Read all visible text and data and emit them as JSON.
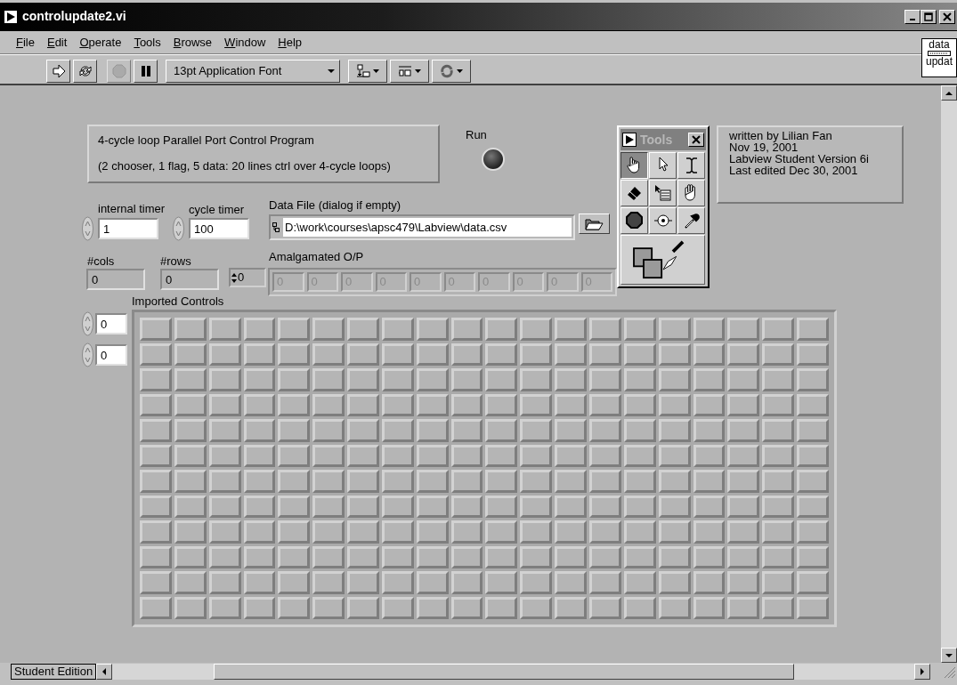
{
  "window": {
    "title": "controlupdate2.vi"
  },
  "menu": [
    {
      "label": "File"
    },
    {
      "label": "Edit"
    },
    {
      "label": "Operate"
    },
    {
      "label": "Tools"
    },
    {
      "label": "Browse"
    },
    {
      "label": "Window"
    },
    {
      "label": "Help"
    }
  ],
  "toolbar": {
    "buttons": [
      {
        "kind": "run",
        "disabled": false
      },
      {
        "kind": "run-continuously",
        "disabled": false
      },
      {
        "kind": "abort",
        "disabled": true
      },
      {
        "kind": "pause",
        "disabled": false
      }
    ],
    "font": "13pt Application Font",
    "tools": [
      {
        "kind": "align"
      },
      {
        "kind": "distribute"
      },
      {
        "kind": "reorder"
      }
    ]
  },
  "connector_pane": {
    "lines": [
      "data",
      "updat"
    ]
  },
  "panel": {
    "title_box": {
      "lines": [
        "4-cycle loop Parallel Port Control Program",
        "(2 chooser, 1 flag, 5 data: 20 lines ctrl over 4-cycle loops)"
      ]
    },
    "run_led": {
      "label": "Run",
      "on": false
    },
    "tools_palette": {
      "title": "Tools",
      "tools": [
        {
          "kind": "operate",
          "selected": true
        },
        {
          "kind": "position",
          "selected": false
        },
        {
          "kind": "text",
          "selected": false
        },
        {
          "kind": "wire",
          "selected": false
        },
        {
          "kind": "shortcut-menu",
          "selected": false
        },
        {
          "kind": "scroll",
          "selected": false
        },
        {
          "kind": "breakpoint",
          "selected": false
        },
        {
          "kind": "probe",
          "selected": false
        },
        {
          "kind": "color-copy",
          "selected": false
        },
        {
          "kind": "coloring",
          "selected": false
        }
      ]
    },
    "info_box": {
      "lines": [
        "written by Lilian Fan",
        "Nov 19, 2001",
        "Labview Student Version 6i",
        "Last edited Dec 30, 2001"
      ]
    },
    "internal_timer": {
      "label": "internal timer",
      "value": "1"
    },
    "cycle_timer": {
      "label": "cycle timer",
      "value": "100"
    },
    "data_file": {
      "label": "Data File (dialog if empty)",
      "value": "D:\\work\\courses\\apsc479\\Labview\\data.csv"
    },
    "cols": {
      "label": "#cols",
      "value": "0"
    },
    "rows": {
      "label": "#rows",
      "value": "0"
    },
    "amalgamated": {
      "label": "Amalgamated O/P",
      "index": "0",
      "disabled": true,
      "values": [
        "0",
        "0",
        "0",
        "0",
        "0",
        "0",
        "0",
        "0",
        "0",
        "0"
      ]
    },
    "imported_controls": {
      "label": "Imported Controls",
      "indices": [
        "0",
        "0"
      ],
      "rows": [
        {
          "buttons_on": [
            false,
            false,
            false,
            false,
            false,
            false,
            false,
            false,
            false,
            false,
            false,
            false,
            false,
            false,
            false,
            false,
            false,
            false,
            false,
            false
          ]
        },
        {
          "buttons_on": [
            false,
            false,
            false,
            false,
            false,
            false,
            false,
            false,
            false,
            false,
            false,
            false,
            false,
            false,
            false,
            false,
            false,
            false,
            false,
            false
          ]
        },
        {
          "buttons_on": [
            false,
            false,
            false,
            false,
            false,
            false,
            false,
            false,
            false,
            false,
            false,
            false,
            false,
            false,
            false,
            false,
            false,
            false,
            false,
            false
          ]
        },
        {
          "buttons_on": [
            false,
            false,
            false,
            false,
            false,
            false,
            false,
            false,
            false,
            false,
            false,
            false,
            false,
            false,
            false,
            false,
            false,
            false,
            false,
            false
          ]
        },
        {
          "buttons_on": [
            false,
            false,
            false,
            false,
            false,
            false,
            false,
            false,
            false,
            false,
            false,
            false,
            false,
            false,
            false,
            false,
            false,
            false,
            false,
            false
          ]
        },
        {
          "buttons_on": [
            false,
            false,
            false,
            false,
            false,
            false,
            false,
            false,
            false,
            false,
            false,
            false,
            false,
            false,
            false,
            false,
            false,
            false,
            false,
            false
          ]
        },
        {
          "buttons_on": [
            false,
            false,
            false,
            false,
            false,
            false,
            false,
            false,
            false,
            false,
            false,
            false,
            false,
            false,
            false,
            false,
            false,
            false,
            false,
            false
          ]
        },
        {
          "buttons_on": [
            false,
            false,
            false,
            false,
            false,
            false,
            false,
            false,
            false,
            false,
            false,
            false,
            false,
            false,
            false,
            false,
            false,
            false,
            false,
            false
          ]
        },
        {
          "buttons_on": [
            false,
            false,
            false,
            false,
            false,
            false,
            false,
            false,
            false,
            false,
            false,
            false,
            false,
            false,
            false,
            false,
            false,
            false,
            false,
            false
          ]
        },
        {
          "buttons_on": [
            false,
            false,
            false,
            false,
            false,
            false,
            false,
            false,
            false,
            false,
            false,
            false,
            false,
            false,
            false,
            false,
            false,
            false,
            false,
            false
          ]
        },
        {
          "buttons_on": [
            false,
            false,
            false,
            false,
            false,
            false,
            false,
            false,
            false,
            false,
            false,
            false,
            false,
            false,
            false,
            false,
            false,
            false,
            false,
            false
          ]
        },
        {
          "buttons_on": [
            false,
            false,
            false,
            false,
            false,
            false,
            false,
            false,
            false,
            false,
            false,
            false,
            false,
            false,
            false,
            false,
            false,
            false,
            false,
            false
          ]
        }
      ]
    }
  },
  "status_bar": {
    "label": "Student Edition"
  }
}
